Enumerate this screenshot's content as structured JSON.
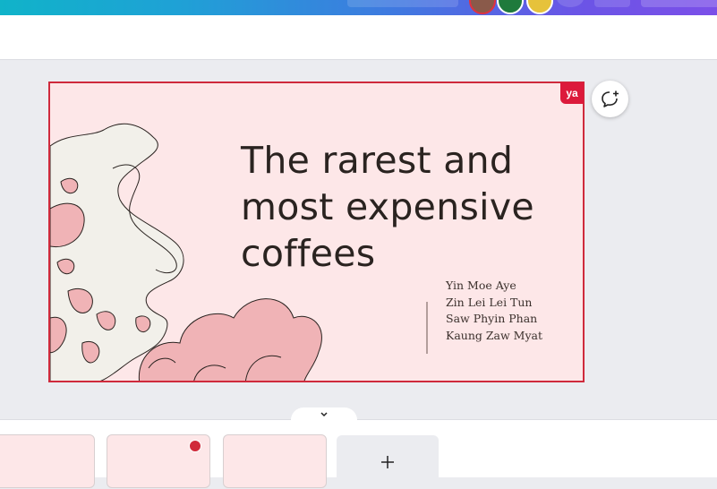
{
  "slide": {
    "title": "The rarest and most expensive coffees",
    "authors": [
      "Yin Moe Aye",
      "Zin Lei Lei Tun",
      "Saw Phyin Phan",
      "Kaung Zaw Myat"
    ],
    "collaborator_badge": "ya"
  },
  "icons": {
    "comment": "add-comment-icon",
    "collapse": "chevron-down-icon",
    "add_page": "plus-icon"
  },
  "colors": {
    "slide_background": "#fde7e8",
    "selection_border": "#cf2a3c",
    "badge": "#dc1a3b",
    "blob_pink": "#f0b3b6",
    "blob_cream": "#f2f0ea"
  }
}
